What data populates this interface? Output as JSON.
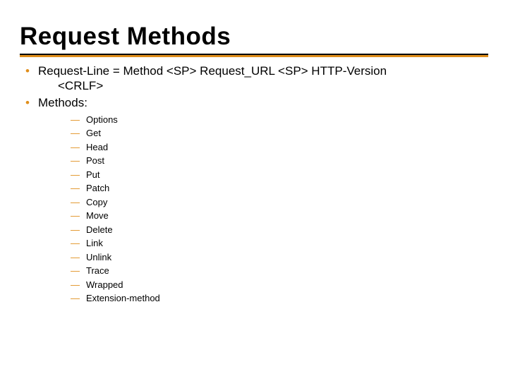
{
  "title": "Request Methods",
  "colors": {
    "accent": "#e08e1b",
    "text": "#000000",
    "bg": "#ffffff"
  },
  "bullets": [
    {
      "text": "Request-Line = Method <SP> Request_URL <SP> HTTP-Version",
      "continuation": "<CRLF>"
    },
    {
      "text": "Methods:",
      "sub": [
        "Options",
        "Get",
        "Head",
        "Post",
        "Put",
        "Patch",
        "Copy",
        "Move",
        "Delete",
        "Link",
        "Unlink",
        "Trace",
        "Wrapped",
        "Extension-method"
      ]
    }
  ]
}
